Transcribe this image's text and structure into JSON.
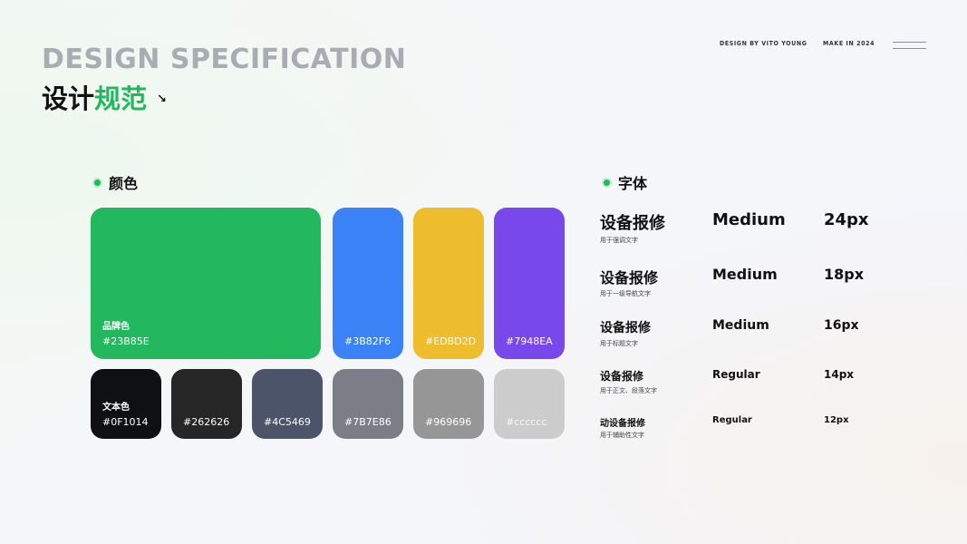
{
  "header": {
    "title_en": "DESIGN SPECIFICATION",
    "title_cn_prefix": "设计",
    "title_cn_highlight": "规范",
    "arrow": "↘",
    "design_by": "DESIGN BY VITO YOUNG",
    "make_in": "MAKE IN 2024"
  },
  "colors_section": {
    "title": "颜色",
    "brand": {
      "name": "品牌色",
      "hex": "#23B85E",
      "color": "#23B85E"
    },
    "accents": [
      {
        "hex": "#3B82F6",
        "color": "#3B82F6"
      },
      {
        "hex": "#EDBD2D",
        "color": "#EDBD2D"
      },
      {
        "hex": "#7948EA",
        "color": "#7948EA"
      }
    ],
    "text_colors": [
      {
        "name": "文本色",
        "hex": "#0F1014",
        "color": "#0F1014"
      },
      {
        "hex": "#262626",
        "color": "#262626"
      },
      {
        "hex": "#4C5469",
        "color": "#4C5469"
      },
      {
        "hex": "#7B7E86",
        "color": "#7B7E86"
      },
      {
        "hex": "#969696",
        "color": "#969696"
      },
      {
        "hex": "#cccccc",
        "color": "#cccccc"
      }
    ]
  },
  "typography_section": {
    "title": "字体",
    "rows": [
      {
        "name": "设备报修",
        "desc": "用于强调文字",
        "weight": "Medium",
        "size": "24px"
      },
      {
        "name": "设备报修",
        "desc": "用于一级导航文字",
        "weight": "Medium",
        "size": "18px"
      },
      {
        "name": "设备报修",
        "desc": "用于标题文字",
        "weight": "Medium",
        "size": "16px"
      },
      {
        "name": "设备报修",
        "desc": "用于正文、段落文字",
        "weight": "Regular",
        "size": "14px"
      },
      {
        "name": "动设备报修",
        "desc": "用于辅助性文字",
        "weight": "Regular",
        "size": "12px"
      }
    ]
  }
}
